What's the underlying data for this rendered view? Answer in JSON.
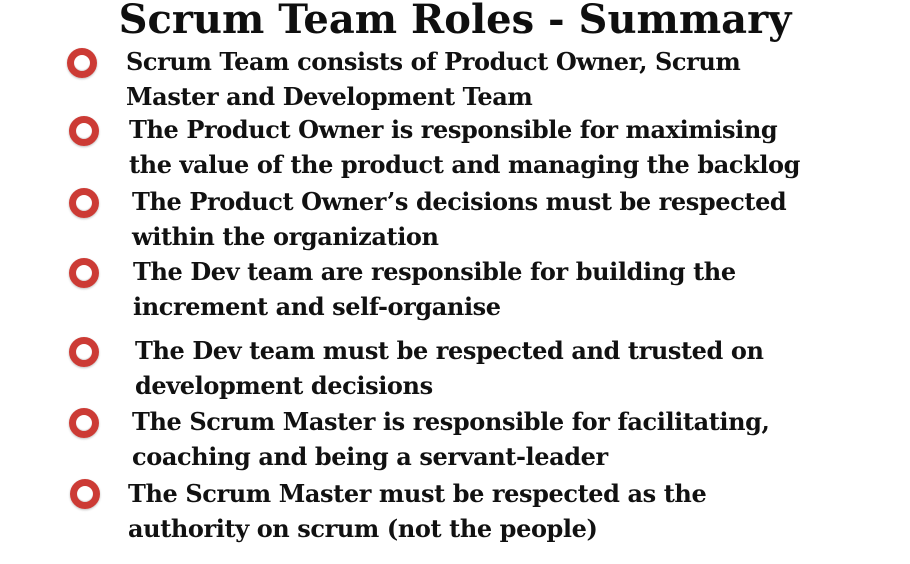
{
  "slide": {
    "title": "Scrum Team Roles - Summary",
    "accent_color": "#cc3b35",
    "bullet_icon": "red-circle-ring-icon",
    "bullets": [
      {
        "line1": "Scrum Team consists of Product Owner, Scrum",
        "line2": "Master and Development Team"
      },
      {
        "line1": "The Product Owner is responsible for maximising",
        "line2": "the value of the product and managing the backlog"
      },
      {
        "line1": "The Product Owner’s decisions must be respected",
        "line2": "within the organization"
      },
      {
        "line1": "The Dev team are responsible for building the",
        "line2": "increment and self-organise"
      },
      {
        "line1": "The Dev team must be respected and trusted on",
        "line2": "development decisions"
      },
      {
        "line1": "The Scrum Master is responsible for facilitating,",
        "line2": "coaching and being a servant-leader"
      },
      {
        "line1": "The Scrum Master must be respected as the",
        "line2": "authority on scrum (not the people)"
      }
    ]
  }
}
